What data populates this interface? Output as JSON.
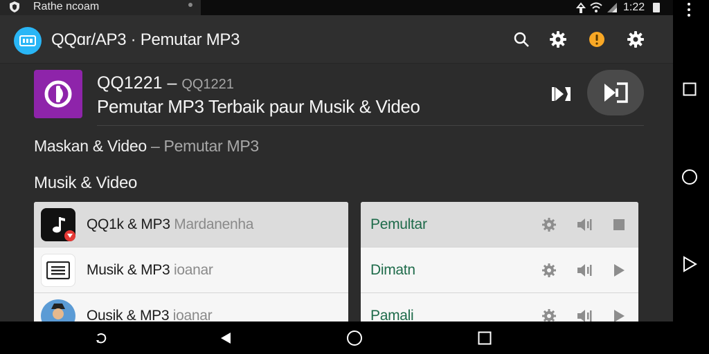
{
  "status_bar": {
    "title": "Rathe ncoam",
    "time": "1:22"
  },
  "app_bar": {
    "title": "QQɑr/AP3 · Pemutar MP3",
    "logo_icon": "app-logo-icon",
    "actions": [
      "search-icon",
      "gear-icon",
      "info-icon",
      "settings-icon"
    ],
    "accent": "#29b6f6"
  },
  "hero": {
    "title": "QQ1221 –",
    "title_sub": "QQ1221",
    "subtitle": "Pemutar MP3 Terbaik paur Musik & Video",
    "icon_color": "#8e24aa"
  },
  "breadcrumb": {
    "primary": "Maskan & Video",
    "separator": " – ",
    "secondary": "Pemutar MP3"
  },
  "section_title": "Musik & Video",
  "list_left": [
    {
      "name": "QQ1k & MP3",
      "muted": "Mardanenha",
      "icon": "music-note-icon"
    },
    {
      "name": "Musik & MP3",
      "muted": "ioanar",
      "icon": "message-list-icon"
    },
    {
      "name": "Ousik & MP3",
      "muted": "ioanar",
      "icon": "avatar-icon"
    }
  ],
  "list_right": [
    {
      "label": "Pemultar",
      "action_icon": "stop-icon"
    },
    {
      "label": "Dimatn",
      "action_icon": "play-icon"
    },
    {
      "label": "Pamali",
      "action_icon": "play-icon"
    }
  ],
  "colors": {
    "list_label": "#1e6b4a",
    "background": "#2c2c2c"
  }
}
